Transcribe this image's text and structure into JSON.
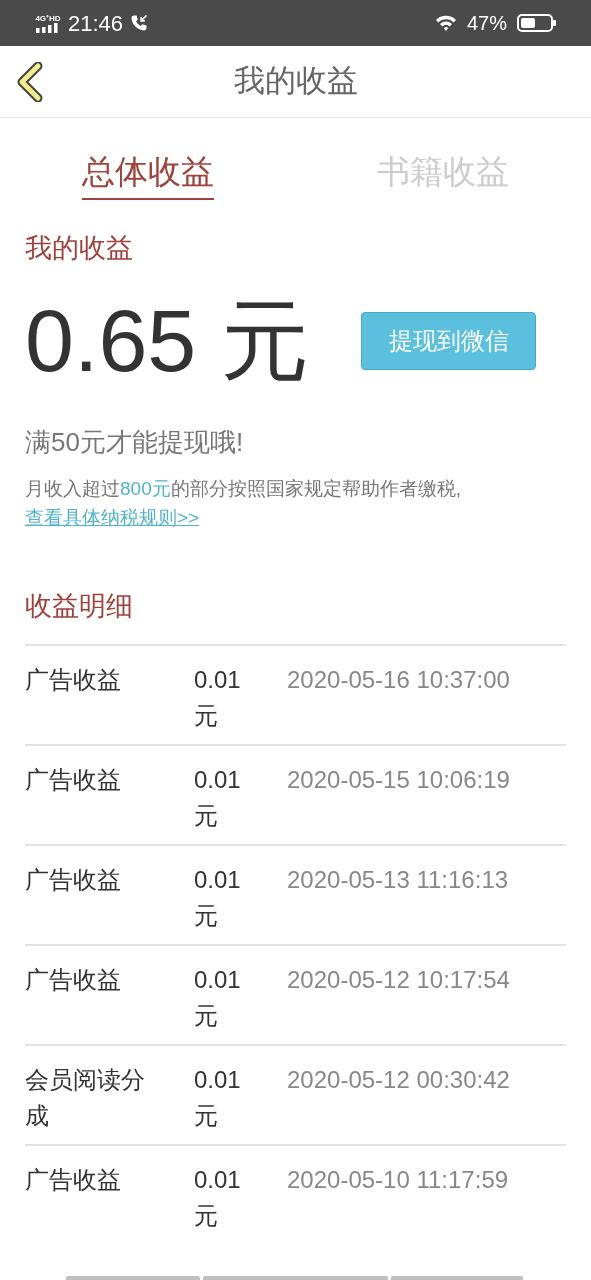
{
  "status_bar": {
    "network": "4G⁺HD",
    "time": "21:46",
    "battery_percent": "47%"
  },
  "header": {
    "title": "我的收益"
  },
  "tabs": [
    {
      "label": "总体收益",
      "selected": true
    },
    {
      "label": "书籍收益",
      "selected": false
    }
  ],
  "earnings": {
    "heading": "我的收益",
    "amount": "0.65 元",
    "withdraw_button": "提现到微信",
    "minimum_note": "满50元才能提现哦!",
    "tax_note": {
      "before": "月收入超过",
      "highlight": "800元",
      "after": "的部分按照国家规定帮助作者缴税,"
    },
    "tax_link": "查看具体纳税规则>>"
  },
  "details": {
    "heading": "收益明细",
    "rows": [
      {
        "type": "广告收益",
        "amount": "0.01元",
        "time": "2020-05-16 10:37:00"
      },
      {
        "type": "广告收益",
        "amount": "0.01元",
        "time": "2020-05-15 10:06:19"
      },
      {
        "type": "广告收益",
        "amount": "0.01元",
        "time": "2020-05-13 11:16:13"
      },
      {
        "type": "广告收益",
        "amount": "0.01元",
        "time": "2020-05-12 10:17:54"
      },
      {
        "type": "会员阅读分成",
        "amount": "0.01元",
        "time": "2020-05-12 00:30:42"
      },
      {
        "type": "广告收益",
        "amount": "0.01元",
        "time": "2020-05-10 11:17:59"
      }
    ]
  }
}
